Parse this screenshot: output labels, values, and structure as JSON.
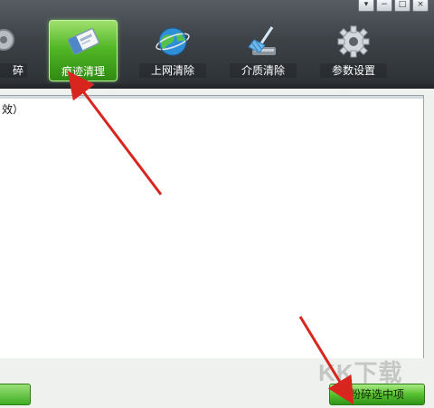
{
  "window_controls": {
    "menu": "▾",
    "minimize": "−",
    "maximize": "□",
    "close": "×"
  },
  "toolbar": {
    "items": [
      {
        "label": "碎",
        "icon": "shredder-gear-icon"
      },
      {
        "label": "痕迹清理",
        "icon": "eraser-icon",
        "active": true
      },
      {
        "label": "上网清除",
        "icon": "globe-icon"
      },
      {
        "label": "介质清除",
        "icon": "broom-icon"
      },
      {
        "label": "参数设置",
        "icon": "gear-icon"
      }
    ]
  },
  "content": {
    "text": "效）"
  },
  "actions": {
    "shred_selected": "粉碎选中项"
  },
  "watermark": {
    "text": "KK下载"
  },
  "colors": {
    "accent_green": "#52b826",
    "arrow_red": "#d8261f"
  }
}
